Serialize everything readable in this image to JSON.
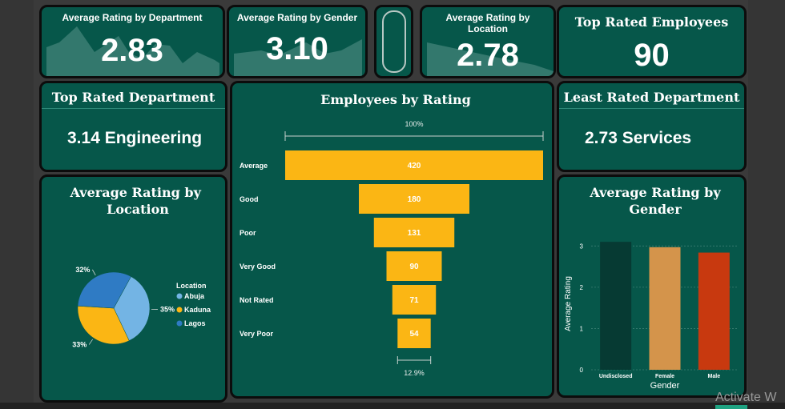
{
  "kpis": {
    "avg_rating_dept": {
      "title": "Average Rating by Department",
      "value": "2.83"
    },
    "avg_rating_gender": {
      "title": "Average Rating by Gender",
      "value": "3.10"
    },
    "avg_rating_location": {
      "title": "Average Rating by Location",
      "value": "2.78"
    },
    "top_rated_employees": {
      "title": "Top Rated Employees",
      "value": "90"
    },
    "top_rated_department": {
      "title": "Top Rated Department",
      "value": "3.14 Engineering"
    },
    "least_rated_department": {
      "title": "Least Rated Department",
      "value": "2.73 Services"
    }
  },
  "watermark": "Activate W",
  "colors": {
    "card_bg": "#06574a",
    "funnel": "#fbb614",
    "undisclosed": "#063a33",
    "female": "#d4944b",
    "male": "#c8390f",
    "abuja": "#73b4e4",
    "kaduna": "#fbb614",
    "lagos": "#2f7bc4"
  },
  "chart_data": [
    {
      "type": "funnel",
      "title": "Employees by Rating",
      "categories": [
        "Average",
        "Good",
        "Poor",
        "Very Good",
        "Not Rated",
        "Very Poor"
      ],
      "values": [
        420,
        180,
        131,
        90,
        71,
        54
      ],
      "top_label": "100%",
      "bottom_label": "12.9%"
    },
    {
      "type": "pie",
      "title": "Average Rating by Location",
      "legend_title": "Location",
      "categories": [
        "Abuja",
        "Kaduna",
        "Lagos"
      ],
      "values": [
        35,
        33,
        32
      ],
      "labels": [
        "35%",
        "33%",
        "32%"
      ],
      "legend": "right"
    },
    {
      "type": "bar",
      "title": "Average Rating by Gender",
      "categories": [
        "Undisclosed",
        "Female",
        "Male"
      ],
      "values": [
        3.1,
        2.97,
        2.84
      ],
      "xlabel": "Gender",
      "ylabel": "Average Rating",
      "ylim": [
        0,
        3.2
      ],
      "yticks": [
        "0",
        "1",
        "2",
        "3"
      ],
      "grid": true
    }
  ]
}
